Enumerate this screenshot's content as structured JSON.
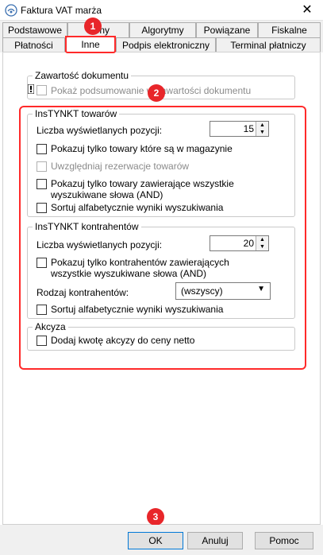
{
  "window": {
    "title": "Faktura VAT marża",
    "close_symbol": "✕",
    "icon": "document-icon"
  },
  "tabs": {
    "row1": [
      "Podstawowe",
      "Ceny",
      "Algorytmy",
      "Powiązane",
      "Fiskalne"
    ],
    "row2": [
      "Płatności",
      "Inne",
      "Podpis elektroniczny",
      "Terminal płatniczy"
    ],
    "active": "Inne"
  },
  "zawartosc": {
    "title": "Zawartość dokumentu",
    "summary_label": "Pokaż podsumowanie w zawartości dokumentu"
  },
  "towarow": {
    "title": "InsTYNKT towarów",
    "count_label": "Liczba wyświetlanych pozycji:",
    "count_value": "15",
    "opt_stock": "Pokazuj tylko towary które są w magazynie",
    "opt_reservation": "Uwzględniaj rezerwacje towarów",
    "opt_allwords": "Pokazuj tylko towary zawierające wszystkie wyszukiwane słowa (AND)",
    "opt_sort": "Sortuj alfabetycznie wyniki wyszukiwania"
  },
  "kontrahentow": {
    "title": "InsTYNKT kontrahentów",
    "count_label": "Liczba wyświetlanych pozycji:",
    "count_value": "20",
    "opt_allwords": "Pokazuj tylko kontrahentów zawierających wszystkie wyszukiwane słowa (AND)",
    "type_label": "Rodzaj kontrahentów:",
    "type_value": "(wszyscy)",
    "opt_sort": "Sortuj alfabetycznie wyniki wyszukiwania"
  },
  "akcyza": {
    "title": "Akcyza",
    "opt_add": "Dodaj kwotę akcyzy do ceny netto"
  },
  "footer": {
    "ok": "OK",
    "cancel": "Anuluj",
    "help": "Pomoc"
  },
  "annotations": {
    "badge1": "1",
    "badge2": "2",
    "badge3": "3",
    "color": "#e8262a"
  }
}
